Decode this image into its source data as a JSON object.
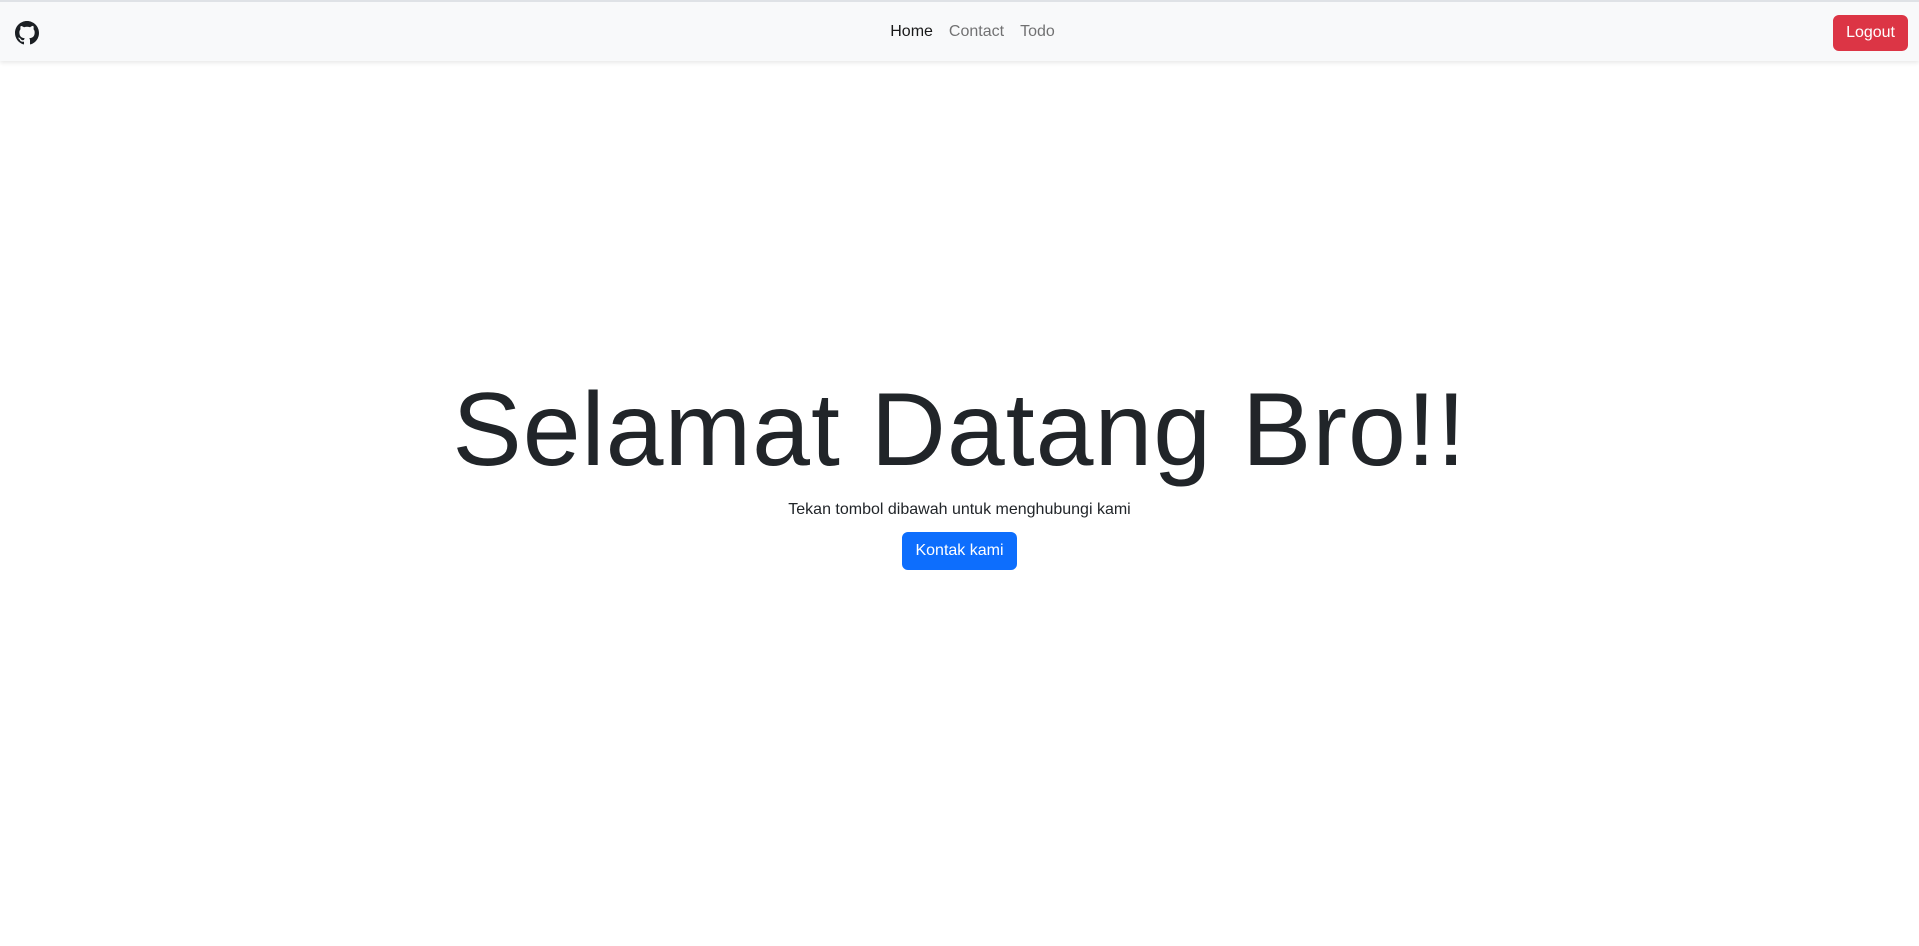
{
  "navbar": {
    "brand_icon": "github-icon",
    "links": [
      {
        "label": "Home",
        "active": true
      },
      {
        "label": "Contact",
        "active": false
      },
      {
        "label": "Todo",
        "active": false
      }
    ],
    "logout_label": "Logout"
  },
  "hero": {
    "title": "Selamat Datang Bro!!",
    "subtitle": "Tekan tombol dibawah untuk menghubungi kami",
    "button_label": "Kontak kami"
  },
  "colors": {
    "navbar_bg": "#f8f9fa",
    "danger": "#dc3545",
    "primary": "#0d6efd",
    "text": "#212529"
  }
}
